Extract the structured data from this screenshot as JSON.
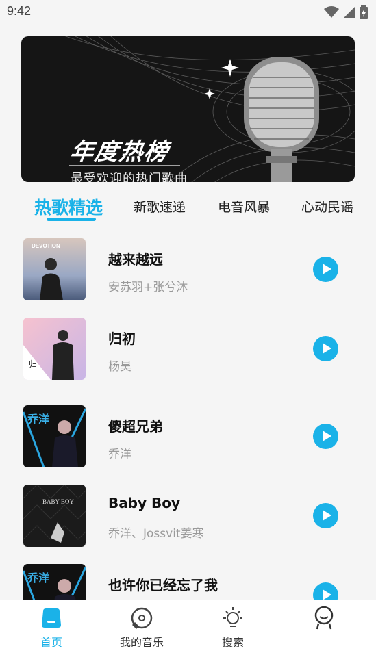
{
  "status_bar": {
    "time": "9:42"
  },
  "banner": {
    "title": "年度热榜",
    "subtitle": "最受欢迎的热门歌曲"
  },
  "tabs": [
    {
      "label": "热歌精选",
      "active": true
    },
    {
      "label": "新歌速递",
      "active": false
    },
    {
      "label": "电音风暴",
      "active": false
    },
    {
      "label": "心动民谣",
      "active": false
    }
  ],
  "songs": [
    {
      "title": "越来越远",
      "artist": "安苏羽+张兮沐",
      "cover_text": "DEVOTION"
    },
    {
      "title": "归初",
      "artist": "杨昊",
      "cover_text": "归"
    },
    {
      "title": "傻超兄弟",
      "artist": "乔洋",
      "cover_text": "乔洋"
    },
    {
      "title": "Baby Boy",
      "artist": "乔洋、Jossvit姜寒",
      "cover_text": "BABY BOY"
    },
    {
      "title": "也许你已经忘了我",
      "artist": "",
      "cover_text": "乔洋"
    }
  ],
  "bottom_nav": [
    {
      "label": "首页",
      "icon": "home-icon",
      "active": true
    },
    {
      "label": "我的音乐",
      "icon": "music-disc-icon",
      "active": false
    },
    {
      "label": "搜索",
      "icon": "lightbulb-icon",
      "active": false
    },
    {
      "label": "",
      "icon": "profile-icon",
      "active": false
    }
  ],
  "colors": {
    "accent": "#1ab2e8",
    "banner_bg": "#151515"
  }
}
